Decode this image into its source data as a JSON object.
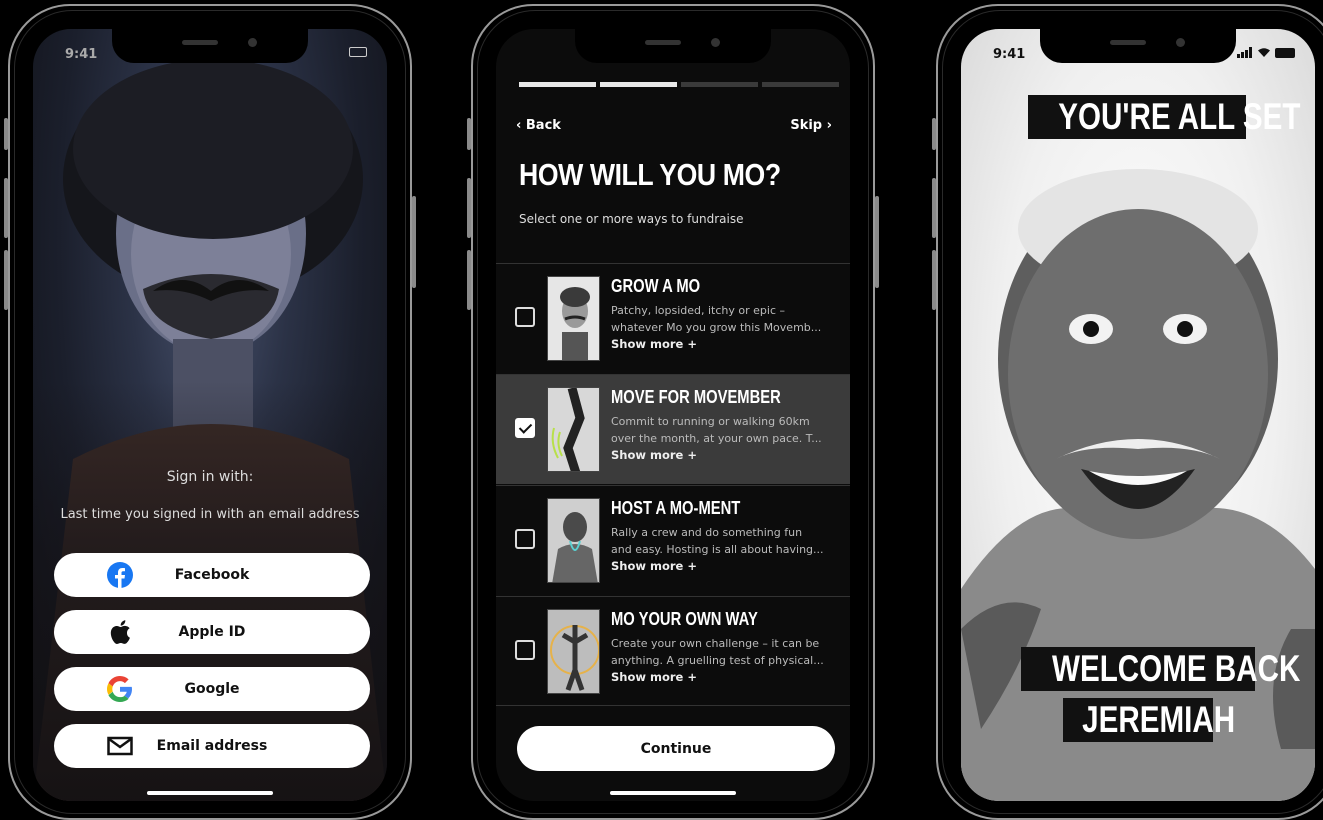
{
  "status_bar": {
    "time": "9:41"
  },
  "phone1": {
    "sign_in_title": "Sign in with:",
    "last_sign_in_note": "Last time you signed in with an email address",
    "buttons": [
      {
        "label": "Facebook",
        "icon": "facebook-icon"
      },
      {
        "label": "Apple ID",
        "icon": "apple-icon"
      },
      {
        "label": "Google",
        "icon": "google-icon"
      },
      {
        "label": "Email address",
        "icon": "mail-icon"
      }
    ]
  },
  "phone2": {
    "progress": {
      "steps": 4,
      "completed": 2
    },
    "back_label": "‹ Back",
    "skip_label": "Skip ›",
    "title": "HOW WILL YOU MO?",
    "subtitle": "Select one or more ways to fundraise",
    "options": [
      {
        "title": "GROW A MO",
        "line1": "Patchy, lopsided, itchy or epic –",
        "line2": "whatever Mo you grow this Movemb...",
        "more": "Show more +",
        "checked": false
      },
      {
        "title": "MOVE FOR MOVEMBER",
        "line1": "Commit to running or walking 60km",
        "line2": "over the month, at your own pace. T...",
        "more": "Show more +",
        "checked": true
      },
      {
        "title": "HOST A MO-MENT",
        "line1": "Rally a crew and do something fun",
        "line2": "and easy. Hosting is all about having...",
        "more": "Show more +",
        "checked": false
      },
      {
        "title": "MO YOUR OWN WAY",
        "line1": "Create your own challenge – it can be",
        "line2": "anything. A gruelling test of physical...",
        "more": "Show more +",
        "checked": false
      }
    ],
    "continue_label": "Continue"
  },
  "phone3": {
    "top_banner": "YOU'RE ALL SET",
    "welcome_line1": "WELCOME BACK",
    "welcome_line2": "JEREMIAH"
  },
  "colors": {
    "accent_dark": "#111111",
    "facebook": "#1877F2",
    "google_blue": "#4285F4",
    "google_red": "#EA4335",
    "google_yellow": "#FBBC05",
    "google_green": "#34A853"
  }
}
